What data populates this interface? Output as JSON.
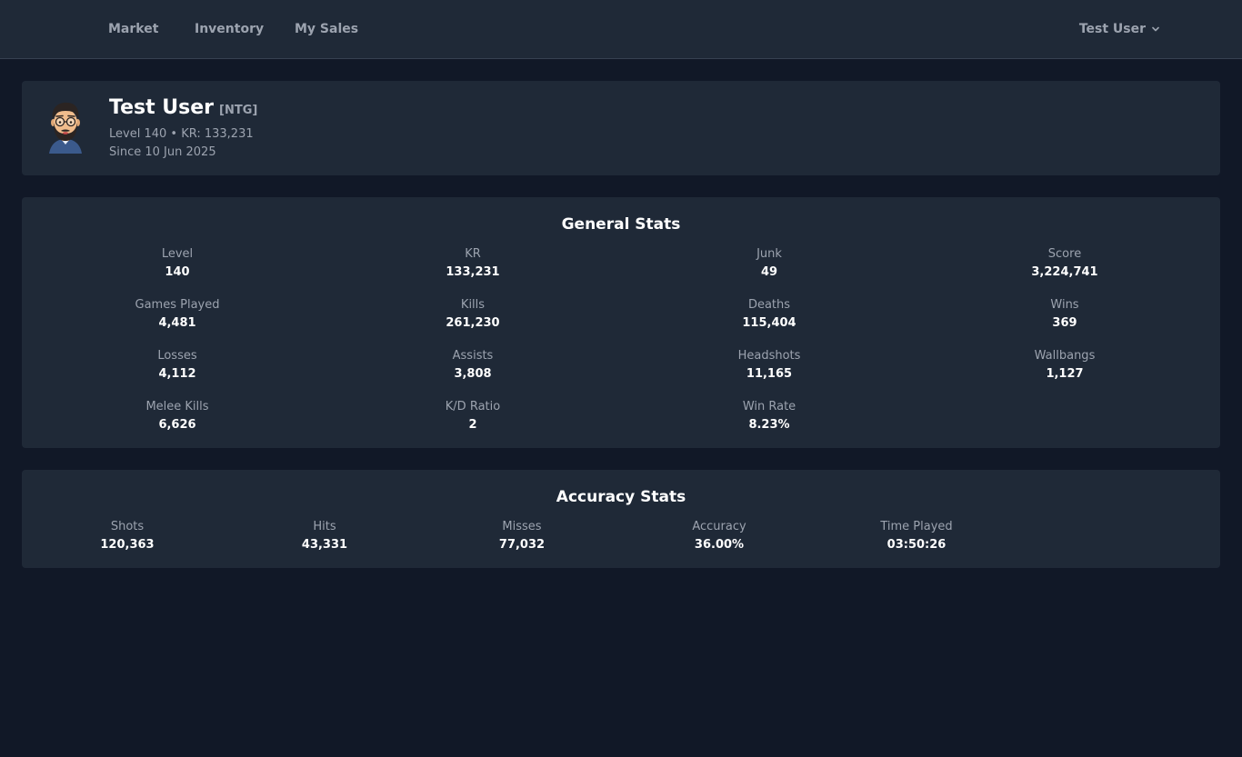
{
  "nav": {
    "links": [
      "Market",
      "Inventory",
      "My Sales"
    ],
    "user_menu_label": "Test User"
  },
  "profile": {
    "name": "Test User",
    "clan": "[NTG]",
    "level_line": "Level 140 • KR: 133,231",
    "since_line": "Since 10 Jun 2025"
  },
  "general_stats": {
    "title": "General Stats",
    "items": [
      {
        "label": "Level",
        "value": "140"
      },
      {
        "label": "KR",
        "value": "133,231"
      },
      {
        "label": "Junk",
        "value": "49"
      },
      {
        "label": "Score",
        "value": "3,224,741"
      },
      {
        "label": "Games Played",
        "value": "4,481"
      },
      {
        "label": "Kills",
        "value": "261,230"
      },
      {
        "label": "Deaths",
        "value": "115,404"
      },
      {
        "label": "Wins",
        "value": "369"
      },
      {
        "label": "Losses",
        "value": "4,112"
      },
      {
        "label": "Assists",
        "value": "3,808"
      },
      {
        "label": "Headshots",
        "value": "11,165"
      },
      {
        "label": "Wallbangs",
        "value": "1,127"
      },
      {
        "label": "Melee Kills",
        "value": "6,626"
      },
      {
        "label": "K/D Ratio",
        "value": "2"
      },
      {
        "label": "Win Rate",
        "value": "8.23%"
      }
    ]
  },
  "accuracy_stats": {
    "title": "Accuracy Stats",
    "items": [
      {
        "label": "Shots",
        "value": "120,363"
      },
      {
        "label": "Hits",
        "value": "43,331"
      },
      {
        "label": "Misses",
        "value": "77,032"
      },
      {
        "label": "Accuracy",
        "value": "36.00%"
      },
      {
        "label": "Time Played",
        "value": "03:50:26"
      }
    ]
  },
  "icons": {
    "user_menu": "chevron-down-icon",
    "avatar": "avatar-emoji-icon"
  },
  "colors": {
    "background": "#111827",
    "card": "#1f2937",
    "muted_text": "#9ca3af",
    "strong_text": "#ffffff"
  }
}
